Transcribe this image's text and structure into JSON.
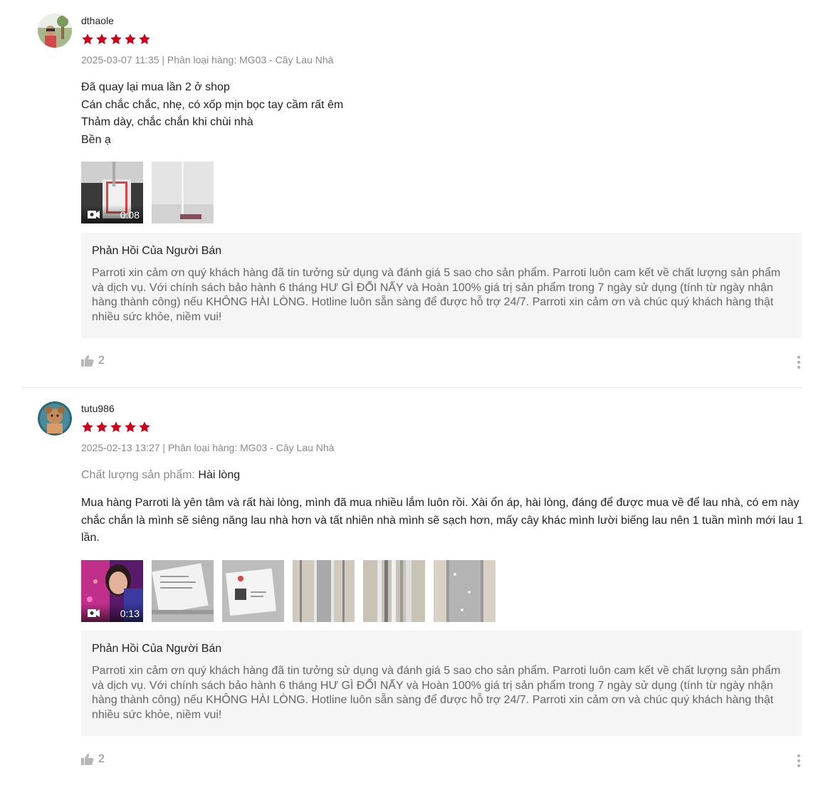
{
  "reviews": [
    {
      "username": "dthaole",
      "rating": 5,
      "meta": "2025-03-07 11:35 | Phân loại hàng: MG03 - Cây Lau Nhà",
      "lines": [
        "Đã quay lại mua lần 2 ở shop",
        "Cán chắc chắc, nhẹ, có xốp mịn bọc tay cầm rất êm",
        "Thảm dày, chắc chắn khi chùi nhà",
        "Bền ạ"
      ],
      "video_duration": "0:08",
      "reply_title": "Phản Hồi Của Người Bán",
      "reply_text": "Parroti xin cảm ơn quý khách hàng đã tin tưởng sử dụng và đánh giá 5 sao cho sản phẩm. Parroti luôn cam kết về chất lượng sản phẩm và dịch vụ. Với chính sách bảo hành 6 tháng HƯ GÌ ĐỔI NẤY và Hoàn 100% giá trị sản phẩm trong 7 ngày sử dụng (tính từ ngày nhận hàng thành công) nếu KHÔNG HÀI LÒNG. Hotline luôn sẵn sàng để được hỗ trợ 24/7. Parroti xin cảm ơn và chúc quý khách hàng thật nhiều sức khỏe, niềm vui!",
      "likes": "2"
    },
    {
      "username": "tutu986",
      "rating": 5,
      "meta": "2025-02-13 13:27 | Phân loại hàng: MG03 - Cây Lau Nhà",
      "quality_label": "Chất lượng sản phẩm:",
      "quality_value": "Hài lòng",
      "text": "Mua hàng Parroti là yên tâm và rất hài lòng, mình đã mua nhiều lắm luôn rồi. Xài ổn áp, hài lòng, đáng để được mua về để lau nhà, có em này chắc chắn là mình sẽ siêng năng lau nhà hơn và tất nhiên nhà mình sẽ sạch hơn, mấy cây khác mình lười biếng lau nên 1 tuần mình mới lau 1 lần.",
      "video_duration": "0:13",
      "reply_title": "Phản Hồi Của Người Bán",
      "reply_text": "Parroti xin cảm ơn quý khách hàng đã tin tưởng sử dụng và đánh giá 5 sao cho sản phẩm. Parroti luôn cam kết về chất lượng sản phẩm và dịch vụ. Với chính sách bảo hành 6 tháng HƯ GÌ ĐỔI NẤY và Hoàn 100% giá trị sản phẩm trong 7 ngày sử dụng (tính từ ngày nhận hàng thành công) nếu KHÔNG HÀI LÒNG. Hotline  luôn sẵn sàng để được hỗ trợ 24/7. Parroti xin cảm ơn và chúc quý khách hàng thật nhiều sức khỏe, niềm vui!",
      "likes": "2"
    }
  ],
  "colors": {
    "star": "#d0011b",
    "muted": "#8a8a8a",
    "reply_bg": "#f5f5f5"
  },
  "icons": [
    "star-icon",
    "camera-icon",
    "thumbs-up-icon",
    "more-options-icon"
  ]
}
